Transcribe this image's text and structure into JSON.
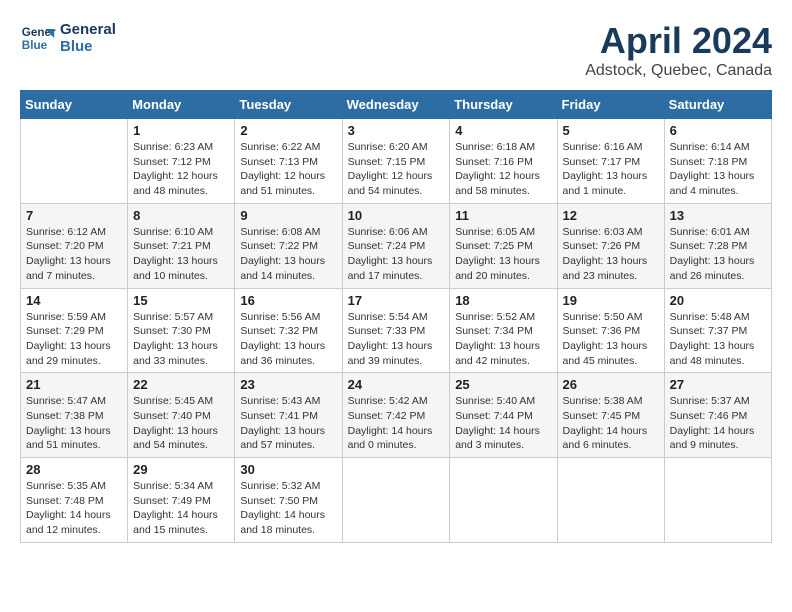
{
  "header": {
    "logo_line1": "General",
    "logo_line2": "Blue",
    "title": "April 2024",
    "subtitle": "Adstock, Quebec, Canada"
  },
  "weekdays": [
    "Sunday",
    "Monday",
    "Tuesday",
    "Wednesday",
    "Thursday",
    "Friday",
    "Saturday"
  ],
  "weeks": [
    [
      {
        "day": "",
        "info": ""
      },
      {
        "day": "1",
        "info": "Sunrise: 6:23 AM\nSunset: 7:12 PM\nDaylight: 12 hours\nand 48 minutes."
      },
      {
        "day": "2",
        "info": "Sunrise: 6:22 AM\nSunset: 7:13 PM\nDaylight: 12 hours\nand 51 minutes."
      },
      {
        "day": "3",
        "info": "Sunrise: 6:20 AM\nSunset: 7:15 PM\nDaylight: 12 hours\nand 54 minutes."
      },
      {
        "day": "4",
        "info": "Sunrise: 6:18 AM\nSunset: 7:16 PM\nDaylight: 12 hours\nand 58 minutes."
      },
      {
        "day": "5",
        "info": "Sunrise: 6:16 AM\nSunset: 7:17 PM\nDaylight: 13 hours\nand 1 minute."
      },
      {
        "day": "6",
        "info": "Sunrise: 6:14 AM\nSunset: 7:18 PM\nDaylight: 13 hours\nand 4 minutes."
      }
    ],
    [
      {
        "day": "7",
        "info": "Sunrise: 6:12 AM\nSunset: 7:20 PM\nDaylight: 13 hours\nand 7 minutes."
      },
      {
        "day": "8",
        "info": "Sunrise: 6:10 AM\nSunset: 7:21 PM\nDaylight: 13 hours\nand 10 minutes."
      },
      {
        "day": "9",
        "info": "Sunrise: 6:08 AM\nSunset: 7:22 PM\nDaylight: 13 hours\nand 14 minutes."
      },
      {
        "day": "10",
        "info": "Sunrise: 6:06 AM\nSunset: 7:24 PM\nDaylight: 13 hours\nand 17 minutes."
      },
      {
        "day": "11",
        "info": "Sunrise: 6:05 AM\nSunset: 7:25 PM\nDaylight: 13 hours\nand 20 minutes."
      },
      {
        "day": "12",
        "info": "Sunrise: 6:03 AM\nSunset: 7:26 PM\nDaylight: 13 hours\nand 23 minutes."
      },
      {
        "day": "13",
        "info": "Sunrise: 6:01 AM\nSunset: 7:28 PM\nDaylight: 13 hours\nand 26 minutes."
      }
    ],
    [
      {
        "day": "14",
        "info": "Sunrise: 5:59 AM\nSunset: 7:29 PM\nDaylight: 13 hours\nand 29 minutes."
      },
      {
        "day": "15",
        "info": "Sunrise: 5:57 AM\nSunset: 7:30 PM\nDaylight: 13 hours\nand 33 minutes."
      },
      {
        "day": "16",
        "info": "Sunrise: 5:56 AM\nSunset: 7:32 PM\nDaylight: 13 hours\nand 36 minutes."
      },
      {
        "day": "17",
        "info": "Sunrise: 5:54 AM\nSunset: 7:33 PM\nDaylight: 13 hours\nand 39 minutes."
      },
      {
        "day": "18",
        "info": "Sunrise: 5:52 AM\nSunset: 7:34 PM\nDaylight: 13 hours\nand 42 minutes."
      },
      {
        "day": "19",
        "info": "Sunrise: 5:50 AM\nSunset: 7:36 PM\nDaylight: 13 hours\nand 45 minutes."
      },
      {
        "day": "20",
        "info": "Sunrise: 5:48 AM\nSunset: 7:37 PM\nDaylight: 13 hours\nand 48 minutes."
      }
    ],
    [
      {
        "day": "21",
        "info": "Sunrise: 5:47 AM\nSunset: 7:38 PM\nDaylight: 13 hours\nand 51 minutes."
      },
      {
        "day": "22",
        "info": "Sunrise: 5:45 AM\nSunset: 7:40 PM\nDaylight: 13 hours\nand 54 minutes."
      },
      {
        "day": "23",
        "info": "Sunrise: 5:43 AM\nSunset: 7:41 PM\nDaylight: 13 hours\nand 57 minutes."
      },
      {
        "day": "24",
        "info": "Sunrise: 5:42 AM\nSunset: 7:42 PM\nDaylight: 14 hours\nand 0 minutes."
      },
      {
        "day": "25",
        "info": "Sunrise: 5:40 AM\nSunset: 7:44 PM\nDaylight: 14 hours\nand 3 minutes."
      },
      {
        "day": "26",
        "info": "Sunrise: 5:38 AM\nSunset: 7:45 PM\nDaylight: 14 hours\nand 6 minutes."
      },
      {
        "day": "27",
        "info": "Sunrise: 5:37 AM\nSunset: 7:46 PM\nDaylight: 14 hours\nand 9 minutes."
      }
    ],
    [
      {
        "day": "28",
        "info": "Sunrise: 5:35 AM\nSunset: 7:48 PM\nDaylight: 14 hours\nand 12 minutes."
      },
      {
        "day": "29",
        "info": "Sunrise: 5:34 AM\nSunset: 7:49 PM\nDaylight: 14 hours\nand 15 minutes."
      },
      {
        "day": "30",
        "info": "Sunrise: 5:32 AM\nSunset: 7:50 PM\nDaylight: 14 hours\nand 18 minutes."
      },
      {
        "day": "",
        "info": ""
      },
      {
        "day": "",
        "info": ""
      },
      {
        "day": "",
        "info": ""
      },
      {
        "day": "",
        "info": ""
      }
    ]
  ]
}
